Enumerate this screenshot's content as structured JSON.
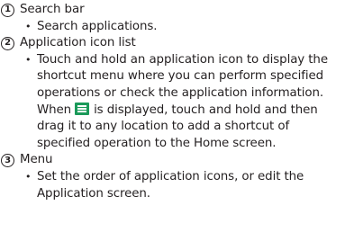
{
  "items": [
    {
      "number": "1",
      "title": "Search bar",
      "desc_lines": [
        "Search applications."
      ]
    },
    {
      "number": "2",
      "title": "Application icon list",
      "desc_lines": [
        "Touch and hold an application icon to display the",
        "shortcut menu where you can perform specified",
        "operations or check the application information.",
        "When",
        "is displayed, touch and hold and then",
        "drag it to any location to add a shortcut of",
        "specified operation to the Home screen."
      ]
    },
    {
      "number": "3",
      "title": "Menu",
      "desc_lines": [
        "Set the order of application icons, or edit the",
        "Application screen."
      ]
    }
  ],
  "icons": {
    "inline_menu_icon": "menu-drag-icon",
    "inline_menu_icon_color": "#1b9a5a"
  }
}
